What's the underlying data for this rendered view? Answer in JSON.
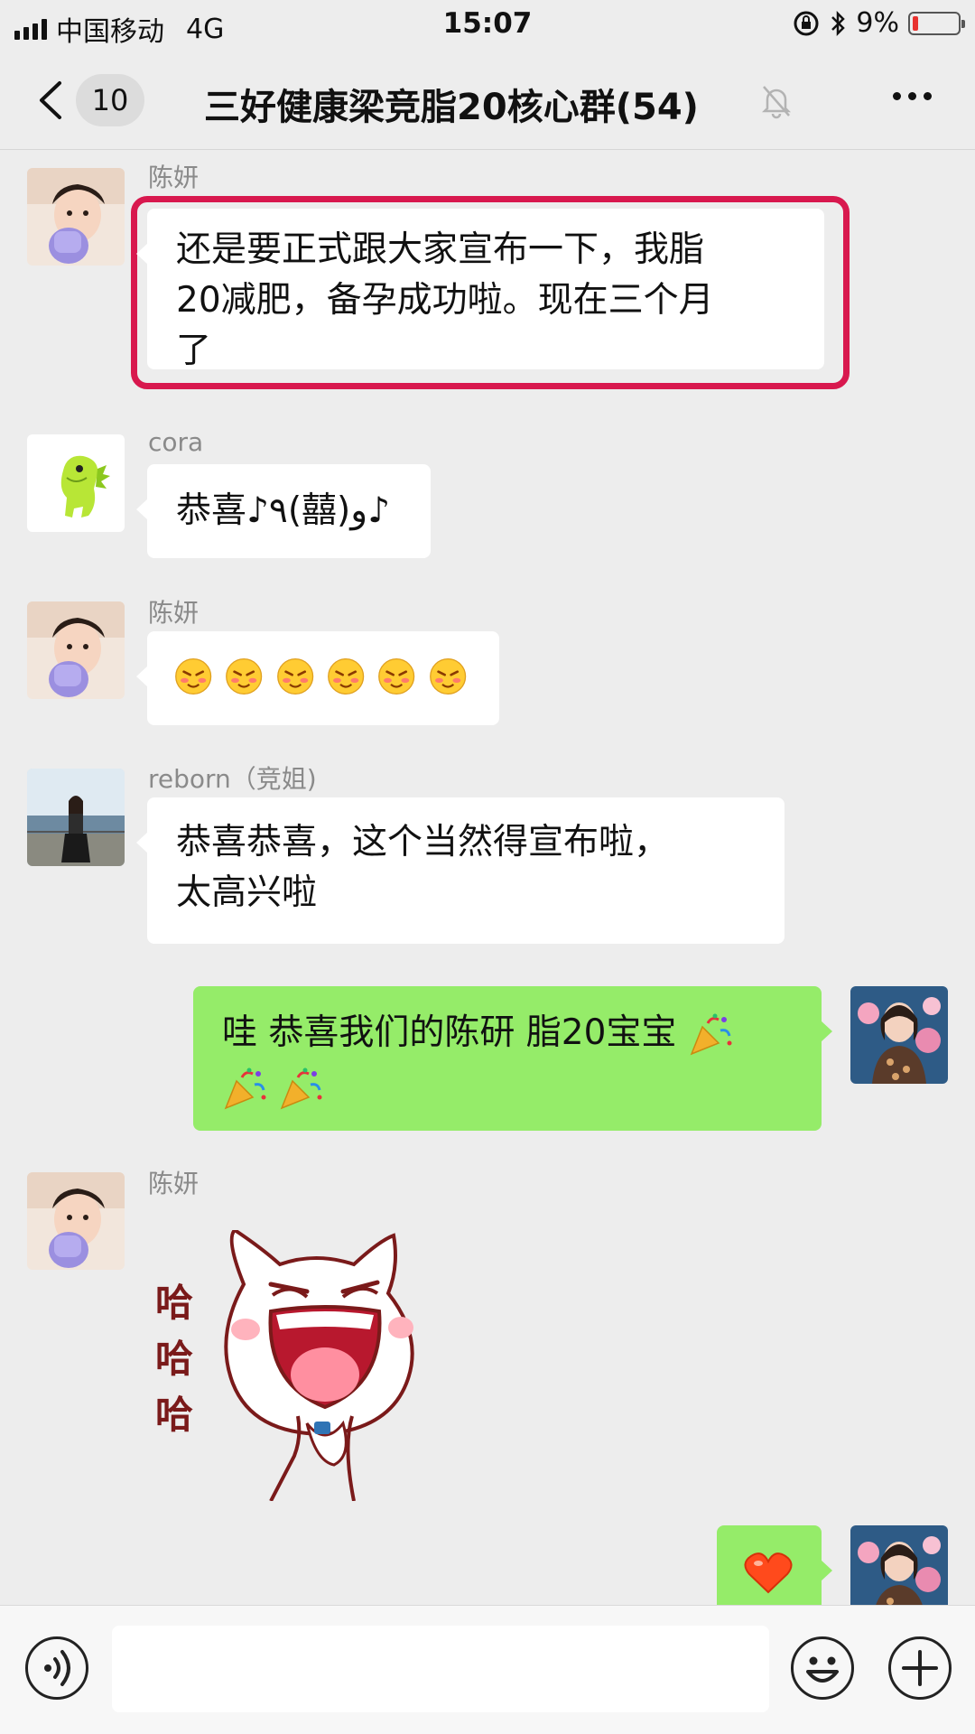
{
  "status_bar": {
    "carrier": "中国移动",
    "network": "4G",
    "time": "15:07",
    "battery": "9%",
    "battery_color": "#e8322f"
  },
  "nav": {
    "unread_count": "10",
    "title": "三好健康梁竞脂20核心群(54)",
    "icons": [
      "chevron-left-icon",
      "mute-bell-icon",
      "more-dots-icon"
    ]
  },
  "messages": [
    {
      "side": "left",
      "sender": "陈妍",
      "lines": [
        "还是要正式跟大家宣布一下，我脂",
        "20减肥，备孕成功啦。现在三个月",
        "了"
      ],
      "highlighted": true
    },
    {
      "side": "left",
      "sender": "cora",
      "lines": [
        "恭喜♪٩(囍)و♪"
      ]
    },
    {
      "side": "left",
      "sender": "陈妍",
      "emoji": "blushing-face-icon",
      "emoji_count": 6
    },
    {
      "side": "left",
      "sender": "reborn（竞姐)",
      "lines": [
        "恭喜恭喜，这个当然得宣布啦，",
        "太高兴啦"
      ]
    },
    {
      "side": "right",
      "lines": [
        "哇 恭喜我们的陈研 脂20宝宝"
      ],
      "emoji": "party-popper-icon"
    },
    {
      "side": "left",
      "sender": "陈妍",
      "sticker_text": [
        "哈",
        "哈",
        "哈"
      ]
    },
    {
      "side": "right",
      "emoji": "heart-icon"
    }
  ],
  "colors": {
    "background": "#ededed",
    "self_bubble": "#95ec69",
    "other_bubble": "#ffffff",
    "highlight_frame": "#d8184e"
  },
  "input_bar": {
    "placeholder": "",
    "icons": [
      "voice-icon",
      "emoji-smile-icon",
      "plus-icon"
    ]
  }
}
